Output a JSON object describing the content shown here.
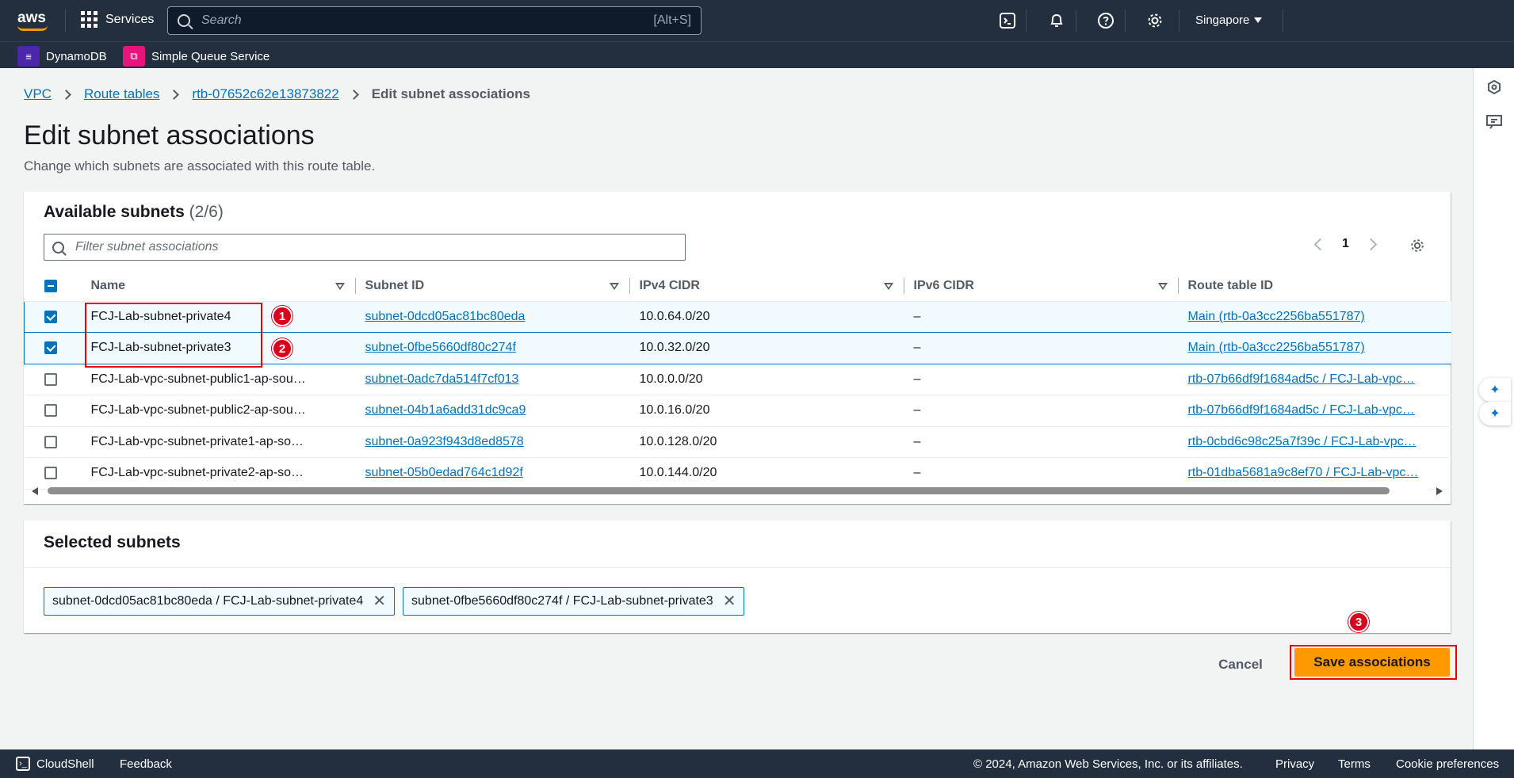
{
  "topnav": {
    "logo_text": "aws",
    "services_label": "Services",
    "search_placeholder": "Search",
    "search_shortcut": "[Alt+S]",
    "region": "Singapore",
    "icons": [
      "cloudshell-icon",
      "bell-icon",
      "help-icon",
      "gear-icon"
    ]
  },
  "favorites": [
    {
      "label": "DynamoDB",
      "icon": "dynamodb-icon",
      "color": "#4d27aa"
    },
    {
      "label": "Simple Queue Service",
      "icon": "sqs-icon",
      "color": "#e7157b"
    }
  ],
  "breadcrumb": [
    {
      "label": "VPC"
    },
    {
      "label": "Route tables"
    },
    {
      "label": "rtb-07652c62e13873822"
    },
    {
      "label": "Edit subnet associations"
    }
  ],
  "page": {
    "title": "Edit subnet associations",
    "subtitle": "Change which subnets are associated with this route table."
  },
  "available": {
    "title": "Available subnets",
    "count": "(2/6)",
    "filter_placeholder": "Filter subnet associations",
    "page_number": "1",
    "columns": [
      "Name",
      "Subnet ID",
      "IPv4 CIDR",
      "IPv6 CIDR",
      "Route table ID"
    ],
    "rows": [
      {
        "checked": true,
        "name": "FCJ-Lab-subnet-private4",
        "subnet_id": "subnet-0dcd05ac81bc80eda",
        "ipv4": "10.0.64.0/20",
        "ipv6": "–",
        "route_table": "Main (rtb-0a3cc2256ba551787)"
      },
      {
        "checked": true,
        "name": "FCJ-Lab-subnet-private3",
        "subnet_id": "subnet-0fbe5660df80c274f",
        "ipv4": "10.0.32.0/20",
        "ipv6": "–",
        "route_table": "Main (rtb-0a3cc2256ba551787)"
      },
      {
        "checked": false,
        "name": "FCJ-Lab-vpc-subnet-public1-ap-sou…",
        "subnet_id": "subnet-0adc7da514f7cf013",
        "ipv4": "10.0.0.0/20",
        "ipv6": "–",
        "route_table": "rtb-07b66df9f1684ad5c / FCJ-Lab-vpc…"
      },
      {
        "checked": false,
        "name": "FCJ-Lab-vpc-subnet-public2-ap-sou…",
        "subnet_id": "subnet-04b1a6add31dc9ca9",
        "ipv4": "10.0.16.0/20",
        "ipv6": "–",
        "route_table": "rtb-07b66df9f1684ad5c / FCJ-Lab-vpc…"
      },
      {
        "checked": false,
        "name": "FCJ-Lab-vpc-subnet-private1-ap-so…",
        "subnet_id": "subnet-0a923f943d8ed8578",
        "ipv4": "10.0.128.0/20",
        "ipv6": "–",
        "route_table": "rtb-0cbd6c98c25a7f39c / FCJ-Lab-vpc…"
      },
      {
        "checked": false,
        "name": "FCJ-Lab-vpc-subnet-private2-ap-so…",
        "subnet_id": "subnet-05b0edad764c1d92f",
        "ipv4": "10.0.144.0/20",
        "ipv6": "–",
        "route_table": "rtb-01dba5681a9c8ef70 / FCJ-Lab-vpc…"
      }
    ]
  },
  "selected": {
    "title": "Selected subnets",
    "tokens": [
      "subnet-0dcd05ac81bc80eda / FCJ-Lab-subnet-private4",
      "subnet-0fbe5660df80c274f / FCJ-Lab-subnet-private3"
    ]
  },
  "actions": {
    "cancel": "Cancel",
    "save": "Save associations"
  },
  "annotations": [
    "1",
    "2",
    "3"
  ],
  "footer": {
    "cloudshell": "CloudShell",
    "feedback": "Feedback",
    "copyright": "© 2024, Amazon Web Services, Inc. or its affiliates.",
    "privacy": "Privacy",
    "terms": "Terms",
    "cookies": "Cookie preferences"
  }
}
